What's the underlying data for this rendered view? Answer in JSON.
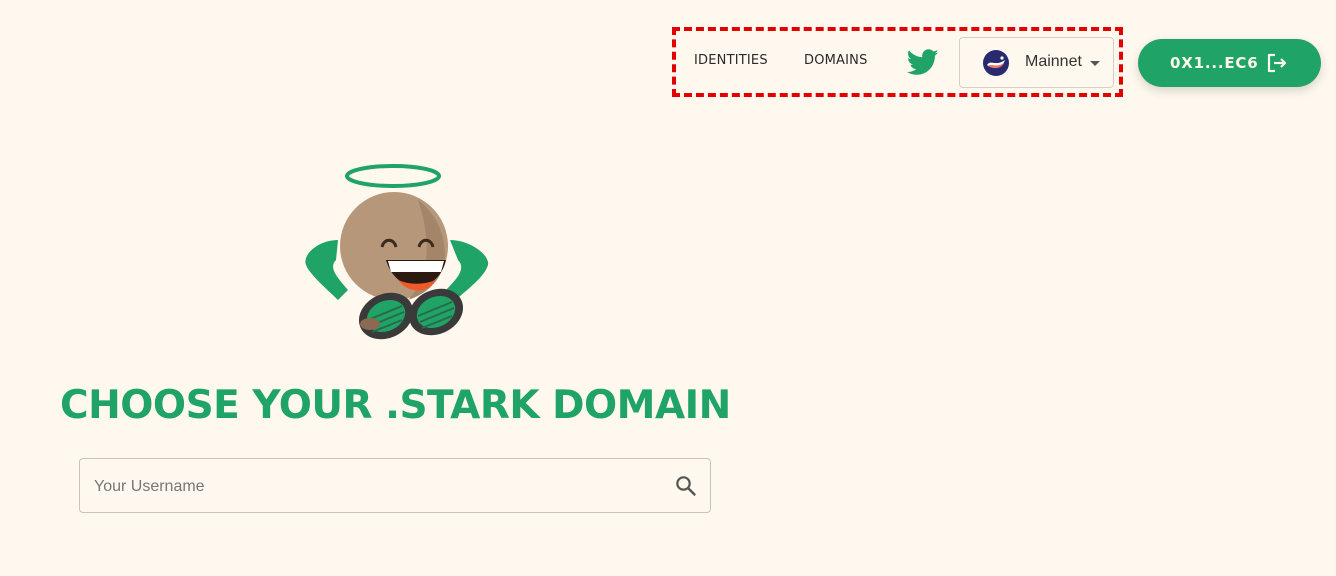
{
  "header": {
    "nav": {
      "identities_label": "IDENTITIES",
      "domains_label": "DOMAINS"
    },
    "twitter_icon": "twitter-bird-icon",
    "network_select": {
      "selected": "Mainnet",
      "icon": "starknet-logo-icon"
    },
    "wallet": {
      "address_label": "0X1...EC6",
      "icon": "logout-icon"
    }
  },
  "main": {
    "mascot_image": "haloed-mascot-illustration",
    "title": "CHOOSE YOUR .STARK DOMAIN",
    "search": {
      "placeholder": "Your Username",
      "value": "",
      "icon": "search-icon"
    }
  },
  "colors": {
    "background": "#FFF8EE",
    "accent": "#1FA366",
    "highlight": "#E30000"
  }
}
